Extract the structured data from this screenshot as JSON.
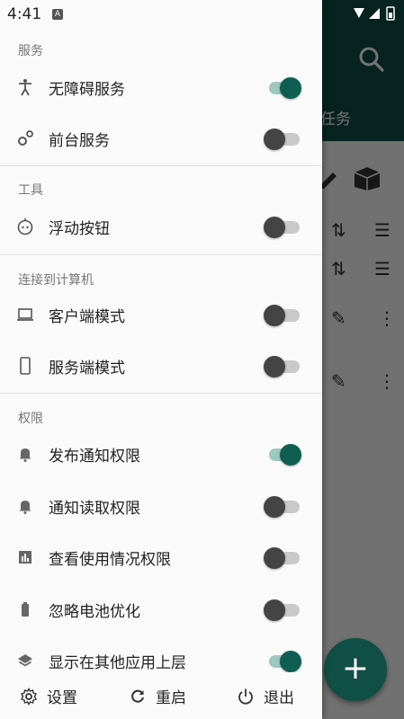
{
  "status_bar": {
    "time": "4:41",
    "notif_badge": "A"
  },
  "background_app": {
    "tab_partial": "任务",
    "fab": "+"
  },
  "drawer": {
    "sections": {
      "services": "服务",
      "tools": "工具",
      "connect": "连接到计算机",
      "permissions": "权限"
    },
    "items": {
      "accessibility": {
        "label": "无障碍服务",
        "icon": "accessibility-icon",
        "on": true
      },
      "foreground": {
        "label": "前台服务",
        "icon": "gears-icon",
        "on": false
      },
      "floating": {
        "label": "浮动按钮",
        "icon": "floating-button-icon",
        "on": false
      },
      "client": {
        "label": "客户端模式",
        "icon": "laptop-icon",
        "on": false
      },
      "server": {
        "label": "服务端模式",
        "icon": "phone-icon",
        "on": false
      },
      "post_notify": {
        "label": "发布通知权限",
        "icon": "bell-icon",
        "on": true
      },
      "read_notify": {
        "label": "通知读取权限",
        "icon": "bell-icon",
        "on": false
      },
      "usage": {
        "label": "查看使用情况权限",
        "icon": "bar-chart-icon",
        "on": false
      },
      "battery": {
        "label": "忽略电池优化",
        "icon": "battery-icon",
        "on": false
      },
      "overlay": {
        "label": "显示在其他应用上层",
        "icon": "layers-icon",
        "on": true
      }
    },
    "bottom": {
      "settings": "设置",
      "restart": "重启",
      "exit": "退出"
    }
  },
  "colors": {
    "accent": "#0f5e52",
    "header": "#0f4f45"
  }
}
